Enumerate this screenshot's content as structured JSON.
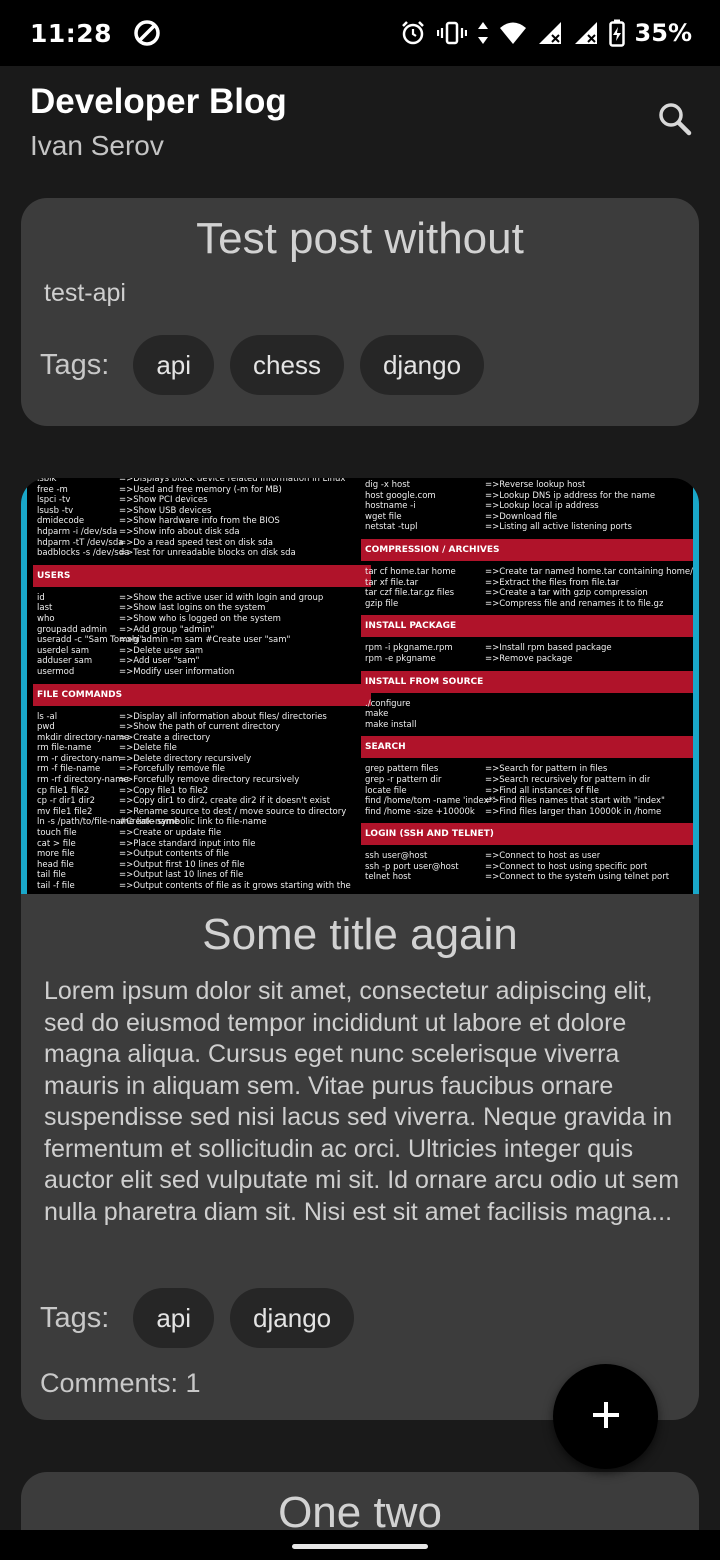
{
  "status_bar": {
    "time": "11:28",
    "battery": "35%",
    "icons": [
      "data-saver-icon",
      "alarm-icon",
      "vibrate-icon",
      "data-arrows-icon",
      "wifi-icon",
      "signal-icon",
      "signal-icon-2",
      "battery-charging-icon"
    ]
  },
  "app_bar": {
    "title": "Developer Blog",
    "subtitle": "Ivan Serov",
    "search_icon": "search-icon"
  },
  "posts": [
    {
      "title": "Test post without",
      "body": "test-api",
      "tags_label": "Tags:",
      "tags": [
        "api",
        "chess",
        "django"
      ]
    },
    {
      "title": "Some title again",
      "body": "Lorem ipsum dolor sit amet, consectetur adipiscing elit, sed do eiusmod tempor incididunt ut labore et dolore magna aliqua. Cursus eget nunc scelerisque viverra mauris in aliquam sem. Vitae purus faucibus ornare suspendisse sed nisi lacus sed viverra. Neque gravida in fermentum et sollicitudin ac orci. Ultricies integer quis auctor elit sed vulputate mi sit. Id ornare arcu odio ut sem nulla pharetra diam sit. Nisi est sit amet facilisis magna...",
      "tags_label": "Tags:",
      "tags": [
        "api",
        "django"
      ],
      "comments": "Comments: 1",
      "image": {
        "left_top": [
          [
            "lsblk",
            "=>Displays block device related information in Linux"
          ],
          [
            "free -m",
            "=>Used and free memory (-m for MB)"
          ],
          [
            "lspci -tv",
            "=>Show PCI devices"
          ],
          [
            "lsusb -tv",
            "=>Show USB devices"
          ],
          [
            "dmidecode",
            "=>Show hardware info from the BIOS"
          ],
          [
            "hdparm -i /dev/sda",
            "=>Show info about disk sda"
          ],
          [
            "hdparm -tT /dev/sda",
            "=>Do a read speed test on disk sda"
          ],
          [
            "badblocks -s /dev/sda",
            "=>Test for unreadable blocks on disk sda"
          ]
        ],
        "users_header": "USERS",
        "users": [
          [
            "id",
            "=>Show the active user id with login and group"
          ],
          [
            "last",
            "=>Show last logins on the system"
          ],
          [
            "who",
            "=>Show who is logged on the system"
          ],
          [
            "groupadd admin",
            "=>Add group \"admin\""
          ],
          [
            "useradd -c \"Sam Tomshi\"",
            "=>g admin -m sam #Create user \"sam\""
          ],
          [
            "userdel sam",
            "=>Delete user sam"
          ],
          [
            "adduser sam",
            "=>Add user \"sam\""
          ],
          [
            "usermod",
            "=>Modify user information"
          ]
        ],
        "file_header": "FILE COMMANDS",
        "files": [
          [
            "ls -al",
            "=>Display all information about files/ directories"
          ],
          [
            "pwd",
            "=>Show the path of current directory"
          ],
          [
            "mkdir directory-name",
            "=>Create a directory"
          ],
          [
            "rm file-name",
            "=>Delete file"
          ],
          [
            "rm -r directory-nam",
            "=>Delete directory recursively"
          ],
          [
            "rm -f file-name",
            "=>Forcefully remove file"
          ],
          [
            "rm -rf directory-name",
            "=>Forcefully remove directory recursively"
          ],
          [
            "cp file1 file2",
            "=>Copy file1 to file2"
          ],
          [
            "cp -r dir1 dir2",
            "=>Copy dir1 to dir2, create dir2 if it doesn't exist"
          ],
          [
            "mv file1 file2",
            "=>Rename source to dest / move source to directory"
          ],
          [
            "ln -s /path/to/file-name link-name",
            "#Create symbolic link to file-name"
          ],
          [
            "touch file",
            "=>Create or update file"
          ],
          [
            "cat > file",
            "=>Place standard input into file"
          ],
          [
            "more file",
            "=>Output contents of file"
          ],
          [
            "head file",
            "=>Output first 10 lines of file"
          ],
          [
            "tail file",
            "=>Output last 10 lines of file"
          ],
          [
            "tail -f file",
            "=>Output contents of file as it grows starting with the"
          ]
        ],
        "right_top": [
          [
            "dig -x host",
            "=>Reverse lookup host"
          ],
          [
            "host google.com",
            "=>Lookup DNS ip address for the name"
          ],
          [
            "hostname -i",
            "=>Lookup local ip address"
          ],
          [
            "wget file",
            "=>Download file"
          ],
          [
            "netstat -tupl",
            "=>Listing all active listening ports"
          ]
        ],
        "compression_header": "COMPRESSION / ARCHIVES",
        "compression": [
          [
            "tar cf home.tar home",
            "=>Create tar named home.tar containing home/"
          ],
          [
            "tar xf file.tar",
            "=>Extract the files from file.tar"
          ],
          [
            "tar czf file.tar.gz files",
            "=>Create a tar with gzip compression"
          ],
          [
            "gzip file",
            "=>Compress file and renames it to file.gz"
          ]
        ],
        "install_pkg_header": "INSTALL PACKAGE",
        "install_pkg": [
          [
            "rpm -i pkgname.rpm",
            "=>Install rpm based package"
          ],
          [
            "rpm -e pkgname",
            "=>Remove package"
          ]
        ],
        "install_src_header": "INSTALL FROM SOURCE",
        "install_src": [
          [
            "./configure",
            ""
          ],
          [
            "make",
            ""
          ],
          [
            "make install",
            ""
          ]
        ],
        "search_header": "SEARCH",
        "search": [
          [
            "grep pattern files",
            "=>Search for pattern in files"
          ],
          [
            "grep -r pattern dir",
            "=>Search recursively for pattern in dir"
          ],
          [
            "locate file",
            "=>Find all instances of file"
          ],
          [
            "find /home/tom -name 'index*'",
            "=>Find files names that start with \"index\""
          ],
          [
            "find /home -size +10000k",
            "=>Find files larger than 10000k in /home"
          ]
        ],
        "login_header": "LOGIN (SSH AND TELNET)",
        "login": [
          [
            "ssh user@host",
            "=>Connect to host as user"
          ],
          [
            "ssh -p port user@host",
            "=>Connect to host using specific port"
          ],
          [
            "telnet host",
            "=>Connect to the system using telnet port"
          ]
        ]
      }
    },
    {
      "title": "One two"
    }
  ],
  "fab": {
    "icon": "plus-icon"
  }
}
